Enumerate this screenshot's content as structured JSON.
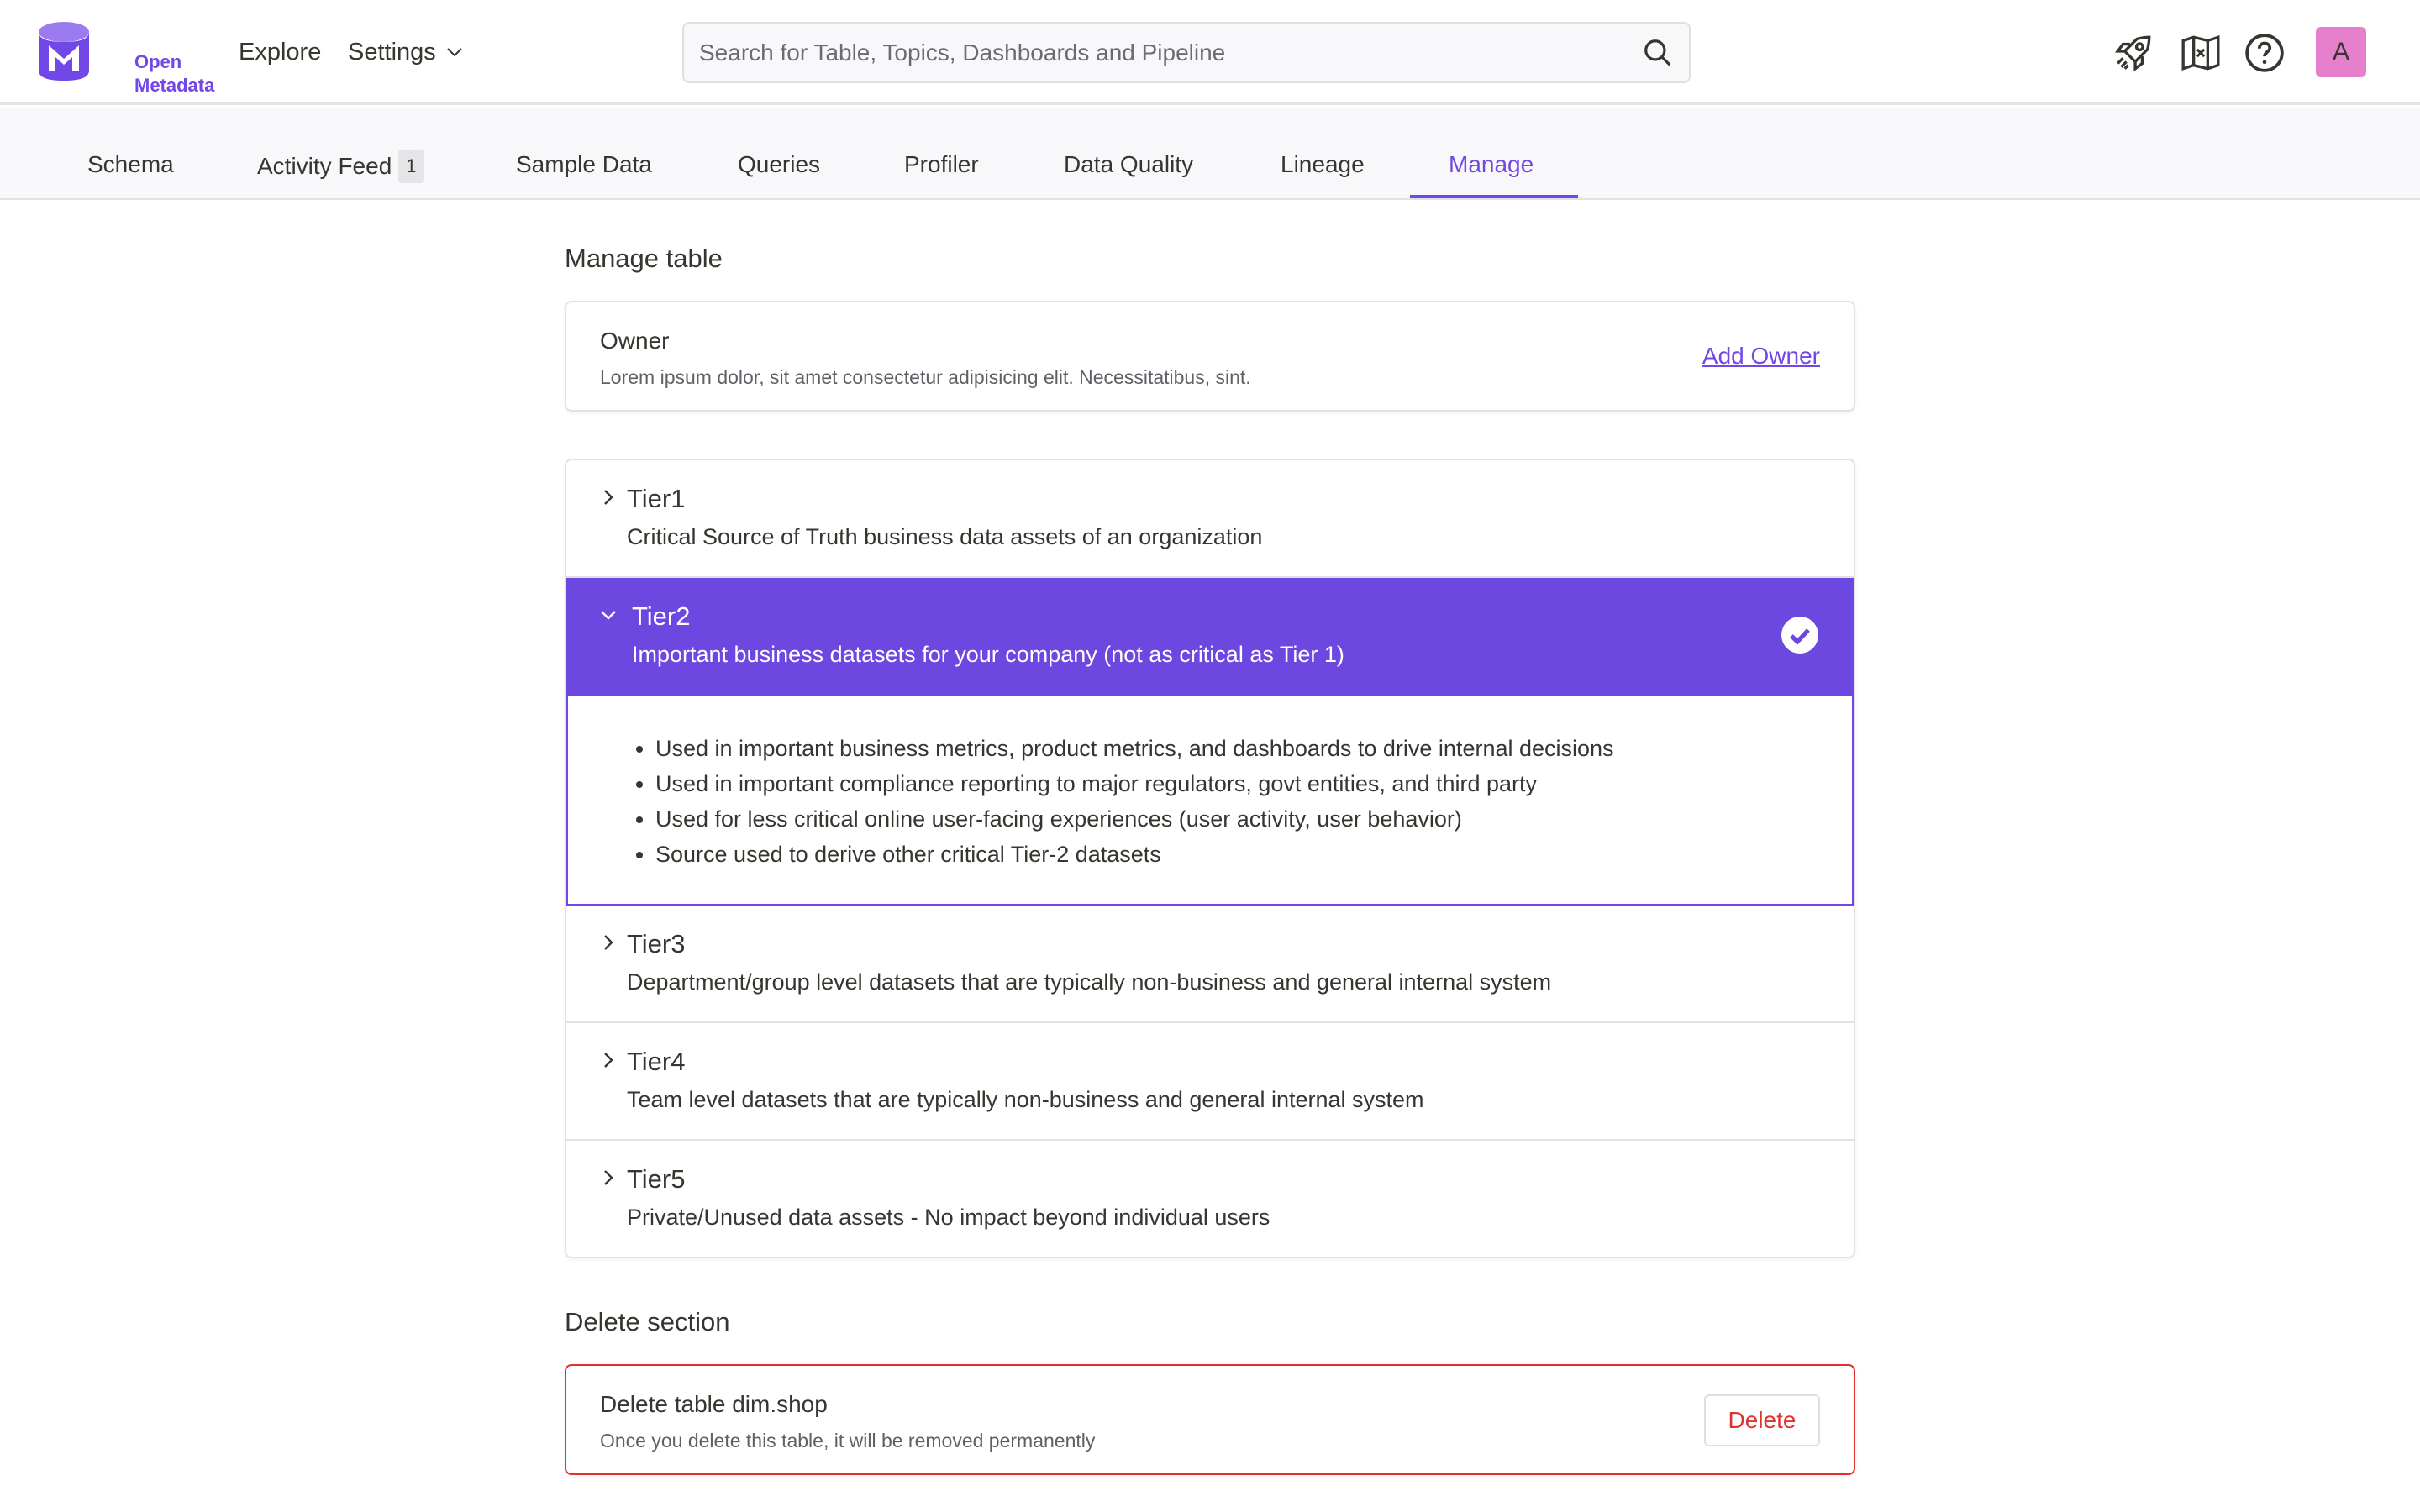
{
  "app": {
    "logo_text_line1": "Open",
    "logo_text_line2": "Metadata"
  },
  "nav": {
    "explore": "Explore",
    "settings": "Settings"
  },
  "search": {
    "placeholder": "Search for Table, Topics, Dashboards and Pipeline",
    "value": ""
  },
  "user": {
    "avatar_initial": "A"
  },
  "icons": {
    "tour": "rocket-icon",
    "docs": "map-icon",
    "help": "help-icon",
    "search": "search-icon"
  },
  "tabs": [
    {
      "label": "Schema"
    },
    {
      "label": "Activity Feed",
      "badge": "1"
    },
    {
      "label": "Sample Data"
    },
    {
      "label": "Queries"
    },
    {
      "label": "Profiler"
    },
    {
      "label": "Data Quality"
    },
    {
      "label": "Lineage"
    },
    {
      "label": "Manage",
      "active": true
    }
  ],
  "manage": {
    "title": "Manage table",
    "owner": {
      "title": "Owner",
      "description": "Lorem ipsum dolor, sit amet consectetur adipisicing elit. Necessitatibus, sint.",
      "action": "Add Owner"
    },
    "tiers": [
      {
        "title": "Tier1",
        "description": "Critical Source of Truth business data assets of an organization"
      },
      {
        "title": "Tier2",
        "description": "Important business datasets for your company (not as critical as Tier 1)",
        "selected": true,
        "details": [
          "Used in important business metrics, product metrics, and dashboards to drive internal decisions",
          "Used in important compliance reporting to major regulators, govt entities, and third party",
          "Used for less critical online user-facing experiences (user activity, user behavior)",
          "Source used to derive other critical Tier-2 datasets"
        ]
      },
      {
        "title": "Tier3",
        "description": "Department/group level datasets that are typically non-business and general internal system"
      },
      {
        "title": "Tier4",
        "description": "Team level datasets that are typically non-business and general internal system"
      },
      {
        "title": "Tier5",
        "description": "Private/Unused data assets - No impact beyond individual users"
      }
    ]
  },
  "delete": {
    "section_title": "Delete section",
    "title": "Delete table dim.shop",
    "description": "Once you delete this table, it will be removed permanently",
    "button": "Delete"
  },
  "colors": {
    "accent": "#7147e8",
    "selected_tier_bg": "#6c48e0",
    "danger": "#e0332e",
    "avatar_bg": "#e680cc"
  }
}
